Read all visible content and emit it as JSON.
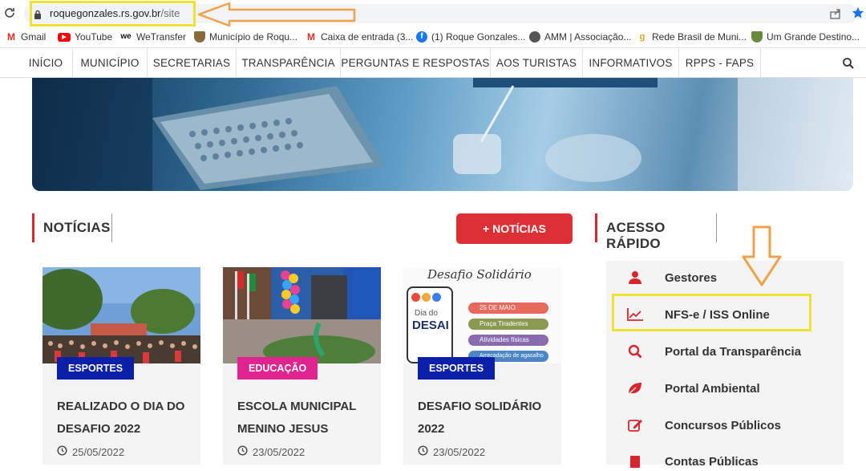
{
  "browser": {
    "url_domain": "roquegonzales.rs.gov.br",
    "url_path": "/site",
    "bookmarks": [
      {
        "label": "Gmail",
        "icon": "gmail-icon",
        "color": "#d93025"
      },
      {
        "label": "YouTube",
        "icon": "youtube-icon",
        "color": "#ff0000"
      },
      {
        "label": "WeTransfer",
        "icon": "wetransfer-icon",
        "color": "#111111"
      },
      {
        "label": "Município de Roqu...",
        "icon": "coat-of-arms-icon",
        "color": "#8a6a3c"
      },
      {
        "label": "Caixa de entrada (3...",
        "icon": "gmail-icon",
        "color": "#d93025"
      },
      {
        "label": "(1) Roque Gonzales...",
        "icon": "facebook-icon",
        "color": "#1877f2"
      },
      {
        "label": "AMM | Associação...",
        "icon": "globe-icon",
        "color": "#555555"
      },
      {
        "label": "Rede Brasil de Muni...",
        "icon": "rede-brasil-icon",
        "color": "#e2a21a"
      },
      {
        "label": "Um Grande Destino...",
        "icon": "coat-of-arms-icon",
        "color": "#6b8a3c"
      }
    ]
  },
  "nav": {
    "items": [
      "INÍCIO",
      "MUNICÍPIO",
      "SECRETARIAS",
      "TRANSPARÊNCIA",
      "PERGUNTAS E RESPOSTAS",
      "AOS TURISTAS",
      "INFORMATIVOS",
      "RPPS - FAPS"
    ]
  },
  "news": {
    "heading": "NOTÍCIAS",
    "more_button": "+ NOTÍCIAS",
    "cards": [
      {
        "category": "ESPORTES",
        "category_color": "#0b1fa8",
        "title": "REALIZADO O DIA DO DESAFIO 2022",
        "date": "25/05/2022"
      },
      {
        "category": "EDUCAÇÃO",
        "category_color": "#e0248f",
        "title": "ESCOLA MUNICIPAL MENINO JESUS",
        "date": "23/05/2022"
      },
      {
        "category": "ESPORTES",
        "category_color": "#0b1fa8",
        "title": "DESAFIO SOLIDÁRIO 2022",
        "date": "23/05/2022"
      }
    ],
    "poster": {
      "title": "Desafio Solidário",
      "phone_line1": "Dia do",
      "phone_line2": "DESAI",
      "pills": [
        "25 DE MAIO",
        "Praça Tiradentes",
        "Atividades físicas",
        "Arrecadação de agasalho"
      ]
    }
  },
  "quick_access": {
    "heading": "ACESSO RÁPIDO",
    "items": [
      {
        "label": "Gestores",
        "icon": "user-icon"
      },
      {
        "label": "NFS-e / ISS Online",
        "icon": "chart-line-icon"
      },
      {
        "label": "Portal da Transparência",
        "icon": "search-icon"
      },
      {
        "label": "Portal Ambiental",
        "icon": "leaf-icon"
      },
      {
        "label": "Concursos Públicos",
        "icon": "edit-icon"
      },
      {
        "label": "Contas Públicas",
        "icon": "book-icon"
      }
    ]
  },
  "colors": {
    "accent_red": "#d7262e",
    "annotation_yellow": "#f0e22e",
    "annotation_orange": "#f0a24a"
  }
}
